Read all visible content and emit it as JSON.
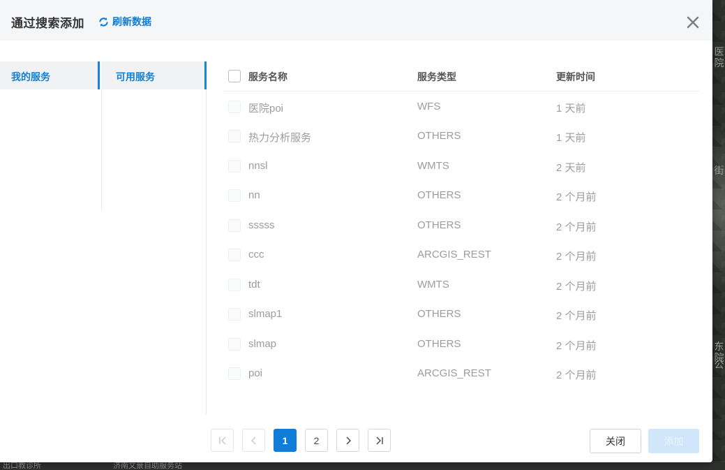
{
  "dialog": {
    "title": "通过搜索添加",
    "refresh_label": "刷新数据"
  },
  "tabs": {
    "my_services": "我的服务",
    "available_services": "可用服务"
  },
  "table": {
    "headers": {
      "name": "服务名称",
      "type": "服务类型",
      "updated": "更新时间"
    },
    "rows": [
      {
        "name": "医院poi",
        "type": "WFS",
        "updated": "1 天前"
      },
      {
        "name": "热力分析服务",
        "type": "OTHERS",
        "updated": "1 天前"
      },
      {
        "name": "nnsl",
        "type": "WMTS",
        "updated": "2 天前"
      },
      {
        "name": "nn",
        "type": "OTHERS",
        "updated": "2 个月前"
      },
      {
        "name": "sssss",
        "type": "OTHERS",
        "updated": "2 个月前"
      },
      {
        "name": "ccc",
        "type": "ARCGIS_REST",
        "updated": "2 个月前"
      },
      {
        "name": "tdt",
        "type": "WMTS",
        "updated": "2 个月前"
      },
      {
        "name": "slmap1",
        "type": "OTHERS",
        "updated": "2 个月前"
      },
      {
        "name": "slmap",
        "type": "OTHERS",
        "updated": "2 个月前"
      },
      {
        "name": "poi",
        "type": "ARCGIS_REST",
        "updated": "2 个月前"
      }
    ]
  },
  "pagination": {
    "pages": [
      "1",
      "2"
    ],
    "current_page": "1"
  },
  "footer": {
    "close_label": "关闭",
    "add_label": "添加"
  },
  "map": {
    "bottom_labels": [
      "出口教诊所",
      "济南文景自助服务站"
    ],
    "right_labels": [
      "医院",
      "街",
      "东院",
      "公"
    ]
  },
  "colors": {
    "accent": "#0f7dd7",
    "header_bg": "#f4f6f8",
    "tab_bg": "#f0f2f4",
    "muted_text": "#9c9c9c",
    "add_disabled_bg": "#cfe6fb"
  }
}
